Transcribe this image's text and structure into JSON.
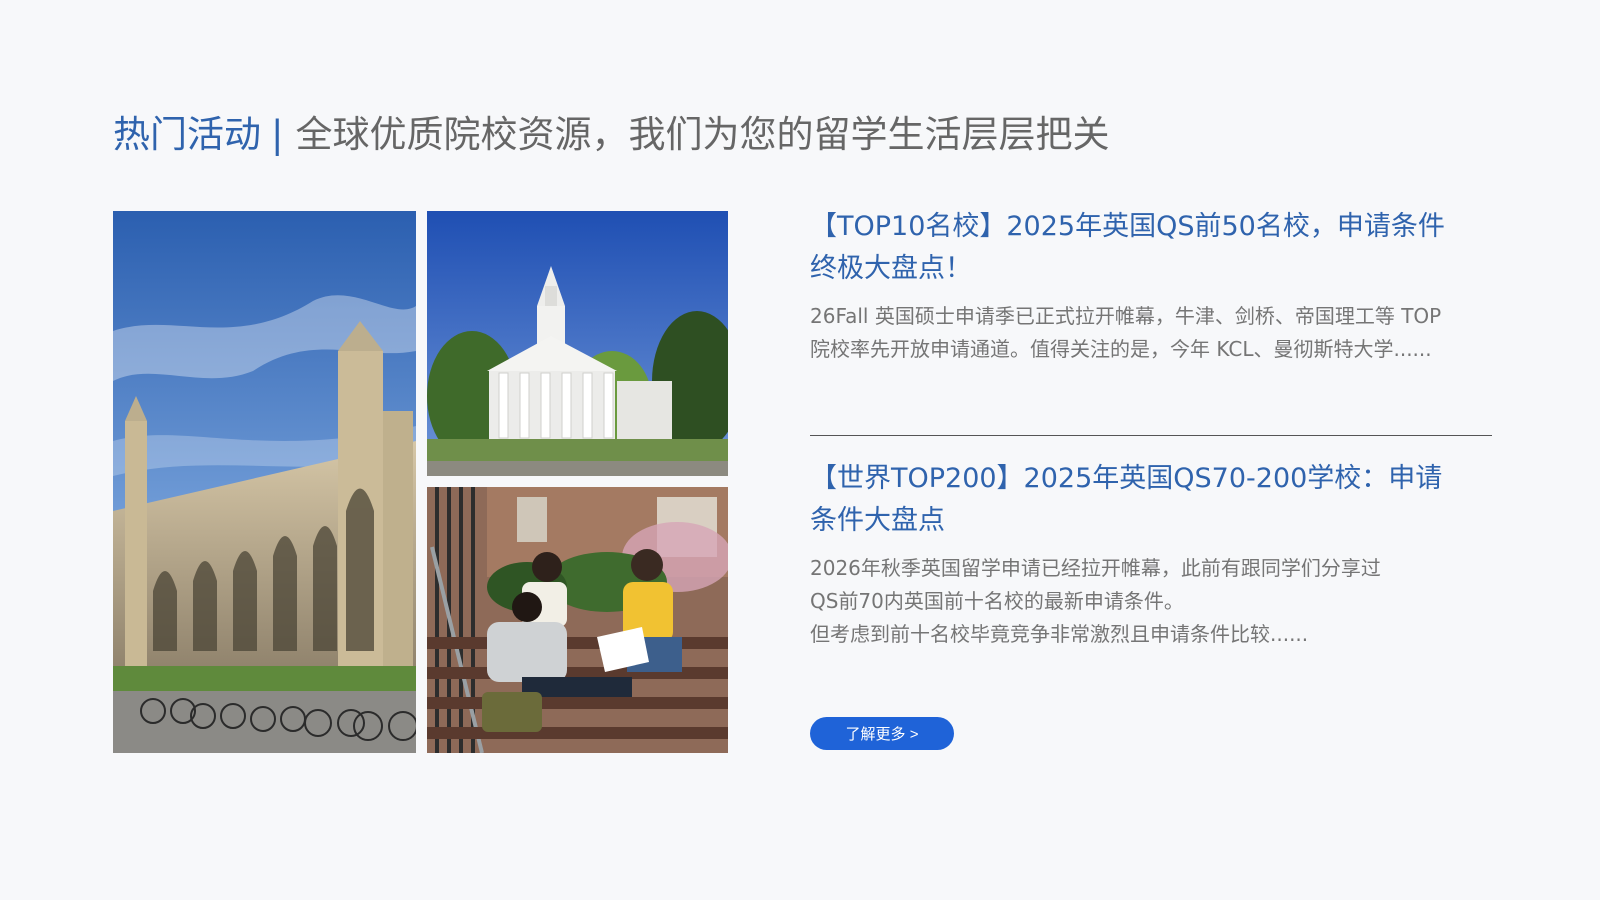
{
  "heading": {
    "accent": "热门活动",
    "separator": "|",
    "subtitle": "全球优质院校资源，我们为您的留学生活层层把关"
  },
  "articles": [
    {
      "title": "【TOP10名校】2025年英国QS前50名校，申请条件终极大盘点！",
      "body": "26Fall 英国硕士申请季已正式拉开帷幕，牛津、剑桥、帝国理工等 TOP 院校率先开放申请通道。值得关注的是，今年 KCL、曼彻斯特大学......"
    },
    {
      "title": "【世界TOP200】2025年英国QS70-200学校：申请条件大盘点",
      "body_lines": [
        "2026年秋季英国留学申请已经拉开帷幕，此前有跟同学们分享过",
        "QS前70内英国前十名校的最新申请条件。",
        "但考虑到前十名校毕竟竞争非常激烈且申请条件比较......"
      ]
    }
  ],
  "button": {
    "label": "了解更多 >"
  },
  "colors": {
    "accent": "#2f63ad",
    "button": "#1f63d8",
    "body_text": "#757575",
    "background": "#f7f8fa"
  }
}
